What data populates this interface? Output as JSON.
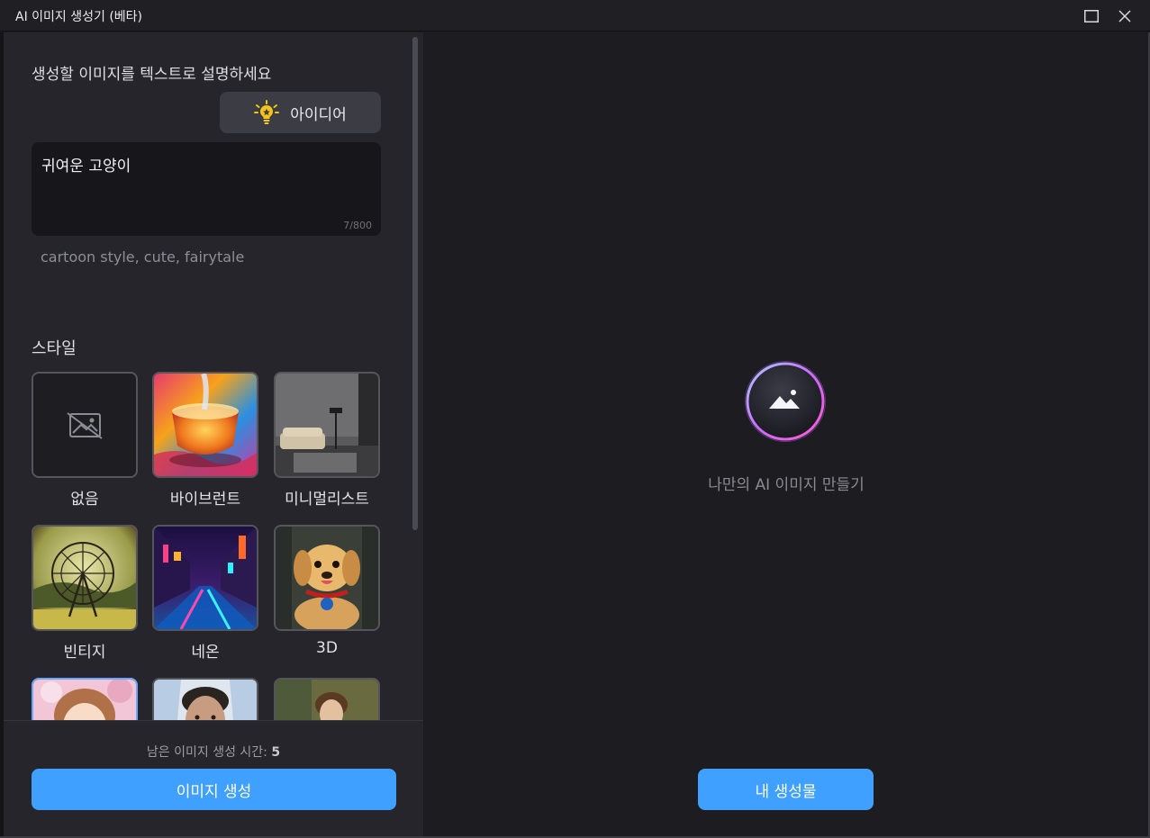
{
  "window": {
    "title": "AI 이미지 생성기 (베타)"
  },
  "prompt": {
    "label": "생성할 이미지를 텍스트로 설명하세요",
    "idea_label": "아이디어",
    "value": "귀여운 고양이",
    "count": "7/800",
    "suggestion": "cartoon style, cute, fairytale"
  },
  "style": {
    "label": "스타일",
    "items": [
      {
        "label": "없음",
        "icon": "image-placeholder-icon"
      },
      {
        "label": "바이브런트"
      },
      {
        "label": "미니멀리스트"
      },
      {
        "label": "빈티지"
      },
      {
        "label": "네온"
      },
      {
        "label": "3D"
      },
      {
        "label": ""
      },
      {
        "label": ""
      },
      {
        "label": ""
      }
    ]
  },
  "footer": {
    "remaining_label": "남은 이미지 생성 시간:",
    "remaining_value": "5",
    "generate_label": "이미지 생성"
  },
  "preview": {
    "placeholder_text": "나만의 AI 이미지 만들기",
    "my_creations_label": "내 생성물"
  },
  "colors": {
    "accent": "#40a0ff",
    "panel": "#25252b",
    "background": "#1c1c21"
  }
}
